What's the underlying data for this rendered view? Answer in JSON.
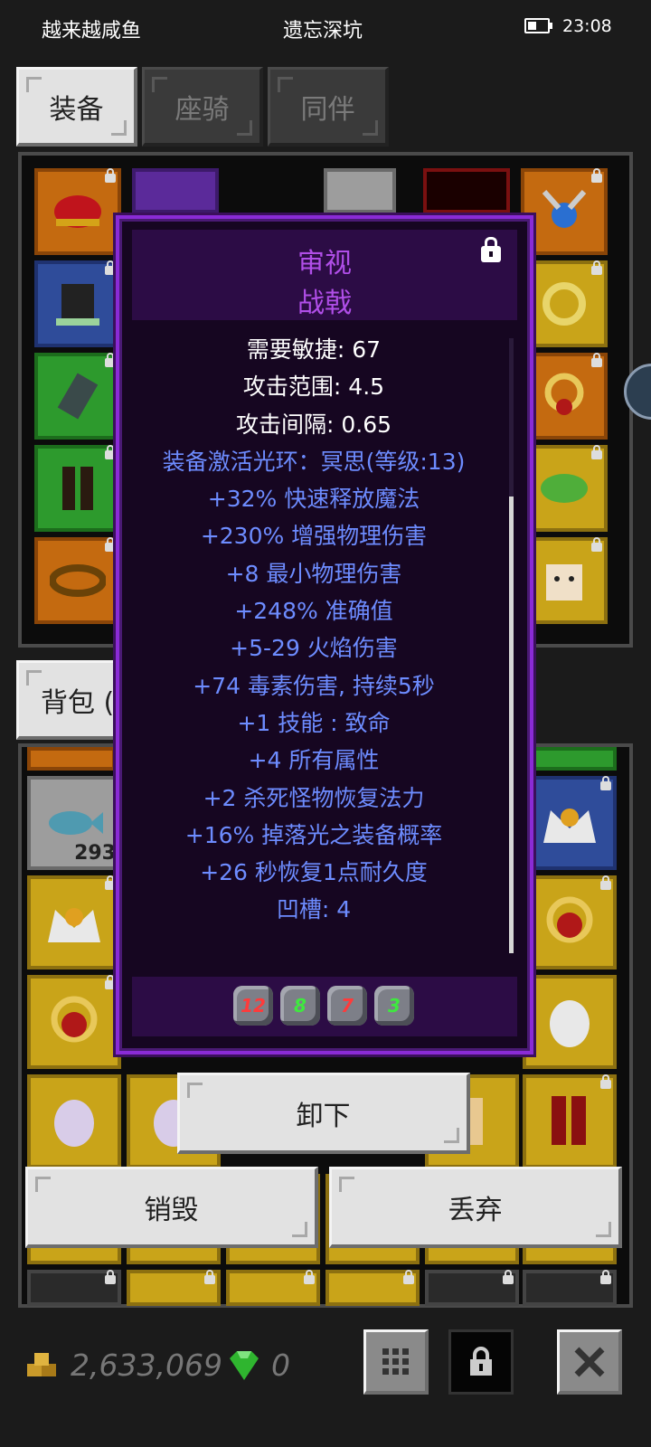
{
  "status_bar": {
    "app_left": "越来越咸鱼",
    "app_center": "遗忘深坑",
    "time": "23:08"
  },
  "tabs": [
    {
      "label": "装备",
      "active": true
    },
    {
      "label": "座骑",
      "active": false
    },
    {
      "label": "同伴",
      "active": false
    }
  ],
  "bag_tab": {
    "label": "背包 ("
  },
  "bag": {
    "stack_count": "293"
  },
  "tooltip": {
    "title": "审视",
    "item_name": "战戟",
    "stats": [
      {
        "text": "需要敏捷: 67",
        "color": "white"
      },
      {
        "text": "攻击范围: 4.5",
        "color": "white"
      },
      {
        "text": "攻击间隔: 0.65",
        "color": "white"
      },
      {
        "text": "装备激活光环：冥思(等级:13)",
        "color": "blue"
      },
      {
        "text": "+32% 快速释放魔法",
        "color": "blue"
      },
      {
        "text": "+230% 增强物理伤害",
        "color": "blue"
      },
      {
        "text": "+8 最小物理伤害",
        "color": "blue"
      },
      {
        "text": "+248% 准确值",
        "color": "blue"
      },
      {
        "text": "+5-29 火焰伤害",
        "color": "blue"
      },
      {
        "text": "+74 毒素伤害, 持续5秒",
        "color": "blue"
      },
      {
        "text": "+1 技能 : 致命",
        "color": "blue"
      },
      {
        "text": "+4 所有属性",
        "color": "blue"
      },
      {
        "text": "+2 杀死怪物恢复法力",
        "color": "blue"
      },
      {
        "text": "+16% 掉落光之装备概率",
        "color": "blue"
      },
      {
        "text": "+26 秒恢复1点耐久度",
        "color": "blue"
      },
      {
        "text": "凹槽: 4",
        "color": "blue"
      }
    ],
    "sockets": [
      {
        "value": "12",
        "color": "red"
      },
      {
        "value": "8",
        "color": "green"
      },
      {
        "value": "7",
        "color": "red"
      },
      {
        "value": "3",
        "color": "green"
      }
    ]
  },
  "actions": {
    "unequip": "卸下",
    "destroy": "销毁",
    "discard": "丢弃"
  },
  "currency": {
    "gold": "2,633,069",
    "gems": "0"
  },
  "colors": {
    "tooltip_border": "#8a2bd6",
    "title_purple": "#b04ee8",
    "stat_blue": "#6d8cff",
    "slot_orange": "#c46a10",
    "slot_yellow": "#c9a419"
  }
}
